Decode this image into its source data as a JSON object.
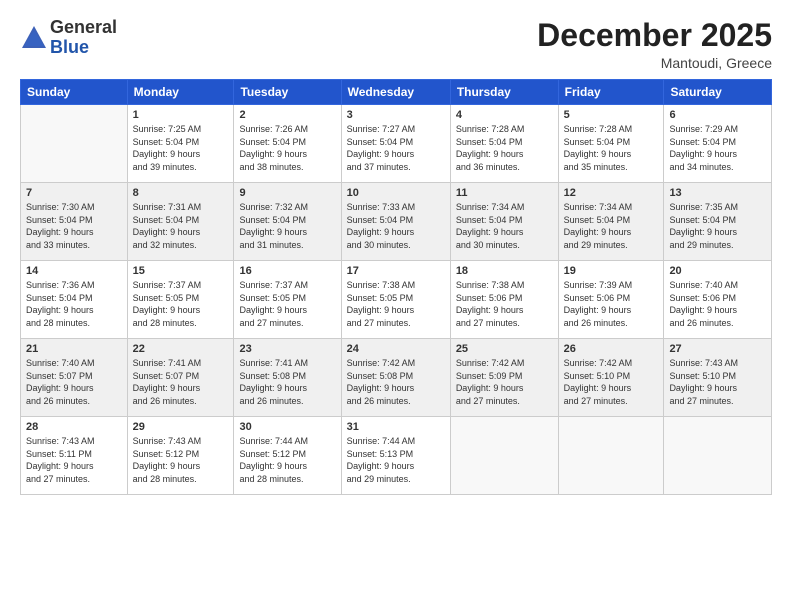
{
  "header": {
    "logo_general": "General",
    "logo_blue": "Blue",
    "month_title": "December 2025",
    "location": "Mantoudi, Greece"
  },
  "weekdays": [
    "Sunday",
    "Monday",
    "Tuesday",
    "Wednesday",
    "Thursday",
    "Friday",
    "Saturday"
  ],
  "weeks": [
    [
      {
        "day": "",
        "info": ""
      },
      {
        "day": "1",
        "info": "Sunrise: 7:25 AM\nSunset: 5:04 PM\nDaylight: 9 hours\nand 39 minutes."
      },
      {
        "day": "2",
        "info": "Sunrise: 7:26 AM\nSunset: 5:04 PM\nDaylight: 9 hours\nand 38 minutes."
      },
      {
        "day": "3",
        "info": "Sunrise: 7:27 AM\nSunset: 5:04 PM\nDaylight: 9 hours\nand 37 minutes."
      },
      {
        "day": "4",
        "info": "Sunrise: 7:28 AM\nSunset: 5:04 PM\nDaylight: 9 hours\nand 36 minutes."
      },
      {
        "day": "5",
        "info": "Sunrise: 7:28 AM\nSunset: 5:04 PM\nDaylight: 9 hours\nand 35 minutes."
      },
      {
        "day": "6",
        "info": "Sunrise: 7:29 AM\nSunset: 5:04 PM\nDaylight: 9 hours\nand 34 minutes."
      }
    ],
    [
      {
        "day": "7",
        "info": "Sunrise: 7:30 AM\nSunset: 5:04 PM\nDaylight: 9 hours\nand 33 minutes."
      },
      {
        "day": "8",
        "info": "Sunrise: 7:31 AM\nSunset: 5:04 PM\nDaylight: 9 hours\nand 32 minutes."
      },
      {
        "day": "9",
        "info": "Sunrise: 7:32 AM\nSunset: 5:04 PM\nDaylight: 9 hours\nand 31 minutes."
      },
      {
        "day": "10",
        "info": "Sunrise: 7:33 AM\nSunset: 5:04 PM\nDaylight: 9 hours\nand 30 minutes."
      },
      {
        "day": "11",
        "info": "Sunrise: 7:34 AM\nSunset: 5:04 PM\nDaylight: 9 hours\nand 30 minutes."
      },
      {
        "day": "12",
        "info": "Sunrise: 7:34 AM\nSunset: 5:04 PM\nDaylight: 9 hours\nand 29 minutes."
      },
      {
        "day": "13",
        "info": "Sunrise: 7:35 AM\nSunset: 5:04 PM\nDaylight: 9 hours\nand 29 minutes."
      }
    ],
    [
      {
        "day": "14",
        "info": "Sunrise: 7:36 AM\nSunset: 5:04 PM\nDaylight: 9 hours\nand 28 minutes."
      },
      {
        "day": "15",
        "info": "Sunrise: 7:37 AM\nSunset: 5:05 PM\nDaylight: 9 hours\nand 28 minutes."
      },
      {
        "day": "16",
        "info": "Sunrise: 7:37 AM\nSunset: 5:05 PM\nDaylight: 9 hours\nand 27 minutes."
      },
      {
        "day": "17",
        "info": "Sunrise: 7:38 AM\nSunset: 5:05 PM\nDaylight: 9 hours\nand 27 minutes."
      },
      {
        "day": "18",
        "info": "Sunrise: 7:38 AM\nSunset: 5:06 PM\nDaylight: 9 hours\nand 27 minutes."
      },
      {
        "day": "19",
        "info": "Sunrise: 7:39 AM\nSunset: 5:06 PM\nDaylight: 9 hours\nand 26 minutes."
      },
      {
        "day": "20",
        "info": "Sunrise: 7:40 AM\nSunset: 5:06 PM\nDaylight: 9 hours\nand 26 minutes."
      }
    ],
    [
      {
        "day": "21",
        "info": "Sunrise: 7:40 AM\nSunset: 5:07 PM\nDaylight: 9 hours\nand 26 minutes."
      },
      {
        "day": "22",
        "info": "Sunrise: 7:41 AM\nSunset: 5:07 PM\nDaylight: 9 hours\nand 26 minutes."
      },
      {
        "day": "23",
        "info": "Sunrise: 7:41 AM\nSunset: 5:08 PM\nDaylight: 9 hours\nand 26 minutes."
      },
      {
        "day": "24",
        "info": "Sunrise: 7:42 AM\nSunset: 5:08 PM\nDaylight: 9 hours\nand 26 minutes."
      },
      {
        "day": "25",
        "info": "Sunrise: 7:42 AM\nSunset: 5:09 PM\nDaylight: 9 hours\nand 27 minutes."
      },
      {
        "day": "26",
        "info": "Sunrise: 7:42 AM\nSunset: 5:10 PM\nDaylight: 9 hours\nand 27 minutes."
      },
      {
        "day": "27",
        "info": "Sunrise: 7:43 AM\nSunset: 5:10 PM\nDaylight: 9 hours\nand 27 minutes."
      }
    ],
    [
      {
        "day": "28",
        "info": "Sunrise: 7:43 AM\nSunset: 5:11 PM\nDaylight: 9 hours\nand 27 minutes."
      },
      {
        "day": "29",
        "info": "Sunrise: 7:43 AM\nSunset: 5:12 PM\nDaylight: 9 hours\nand 28 minutes."
      },
      {
        "day": "30",
        "info": "Sunrise: 7:44 AM\nSunset: 5:12 PM\nDaylight: 9 hours\nand 28 minutes."
      },
      {
        "day": "31",
        "info": "Sunrise: 7:44 AM\nSunset: 5:13 PM\nDaylight: 9 hours\nand 29 minutes."
      },
      {
        "day": "",
        "info": ""
      },
      {
        "day": "",
        "info": ""
      },
      {
        "day": "",
        "info": ""
      }
    ]
  ]
}
